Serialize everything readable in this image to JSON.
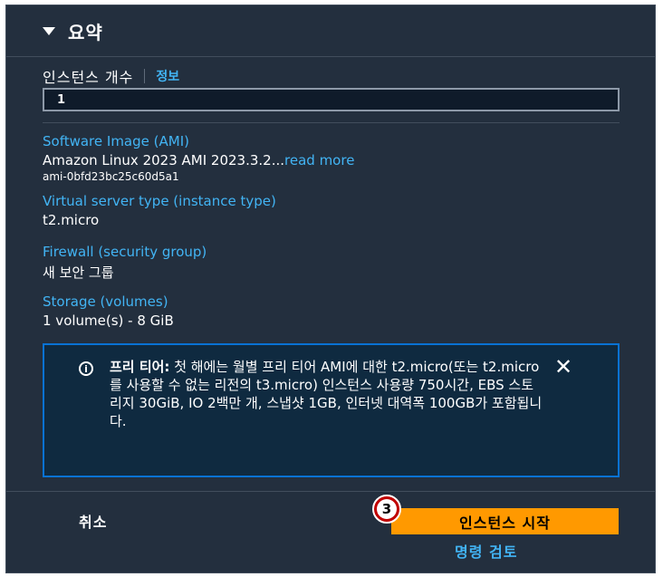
{
  "header": {
    "title": "요약"
  },
  "instance_count": {
    "label": "인스턴스 개수",
    "info_link": "정보",
    "value": "1"
  },
  "ami": {
    "label": "Software Image (AMI)",
    "value": "Amazon Linux 2023 AMI 2023.3.2...",
    "read_more": "read more",
    "id": "ami-0bfd23bc25c60d5a1"
  },
  "instance_type": {
    "label": "Virtual server type (instance type)",
    "value": "t2.micro"
  },
  "firewall": {
    "label": "Firewall (security group)",
    "value": "새 보안 그룹"
  },
  "storage": {
    "label": "Storage (volumes)",
    "value": "1 volume(s) - 8 GiB"
  },
  "free_tier": {
    "heading": "프리 티어:",
    "text": " 첫 해에는 월별 프리 티어 AMI에 대한 t2.micro(또는 t2.micro를 사용할 수 없는 리전의 t3.micro) 인스턴스 사용량 750시간, EBS 스토리지 30GiB, IO 2백만 개, 스냅샷 1GB, 인터넷 대역폭 100GB가 포함됩니다.",
    "icon": "info-icon",
    "close_icon": "close-icon"
  },
  "footer": {
    "cancel_label": "취소",
    "launch_label": "인스턴스 시작",
    "review_label": "명령 검토",
    "step_badge": "3"
  },
  "colors": {
    "panel_bg": "#232f3e",
    "link": "#42b4f4",
    "primary_button": "#ff9900",
    "alert_border": "#0972d3",
    "badge": "#c00000"
  }
}
